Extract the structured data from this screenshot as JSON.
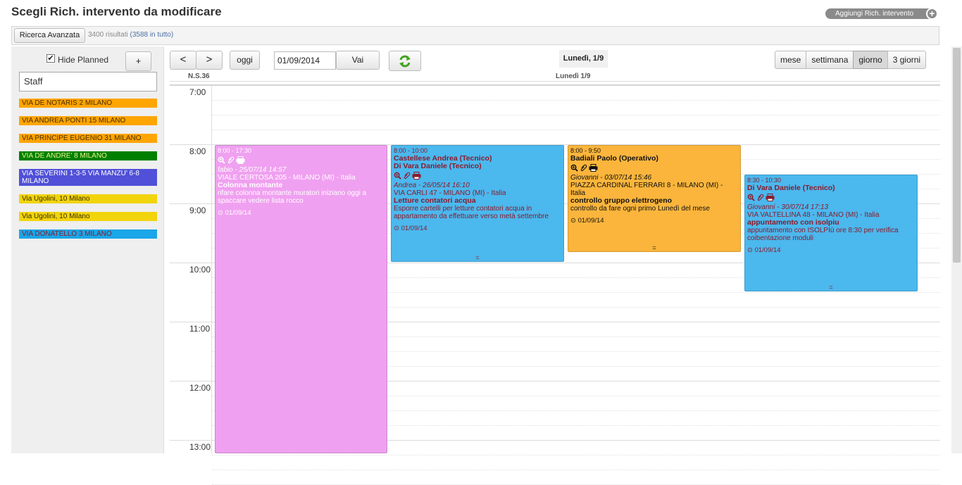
{
  "page": {
    "title": "Scegli Rich. intervento da modificare",
    "add_button": "Aggiungi Rich. intervento",
    "add_plus": "+"
  },
  "toolbar": {
    "advanced_search": "Ricerca Avanzata",
    "results_count": "3400 risultati",
    "results_total": "(3588 in tutto)"
  },
  "sidebar": {
    "hide_planned_label": "Hide Planned",
    "hide_planned_checked": true,
    "check_mark": "✔",
    "plus_label": "+",
    "staff_value": "Staff",
    "chips": [
      {
        "label": "VIA DE NOTARIS 2 MILANO",
        "bg": "#ffa500",
        "fg": "#4a2d00"
      },
      {
        "label": "VIA ANDREA PONTI 15 MILANO",
        "bg": "#ffa500",
        "fg": "#4a2d00"
      },
      {
        "label": "VIA PRINCIPE EUGENIO 31 MILANO",
        "bg": "#ffa500",
        "fg": "#4a2d00"
      },
      {
        "label": "VIA DE ANDRE' 8 MILANO",
        "bg": "#008000",
        "fg": "#e9f48c"
      },
      {
        "label": "VIA SEVERINI 1-3-5 VIA MANZU' 6-8 MILANO",
        "bg": "#5050d8",
        "fg": "#ffffff"
      },
      {
        "label": "Via Ugolini, 10 Milano",
        "bg": "#f2d40c",
        "fg": "#3a2e00"
      },
      {
        "label": "Via Ugolini, 10 Milano",
        "bg": "#f2d40c",
        "fg": "#3a2e00"
      },
      {
        "label": "VIA DONATELLO 3 MILANO",
        "bg": "#1aa6e8",
        "fg": "#8b1b2b"
      }
    ]
  },
  "calendar": {
    "prev": "<",
    "next": ">",
    "today": "oggi",
    "date_value": "01/09/2014",
    "go": "Vai",
    "title": "Lunedì, 1/9",
    "views": [
      "mese",
      "settimana",
      "giorno",
      "3 giorni"
    ],
    "active_view": "giorno",
    "week_label": "N.S.36",
    "day_header": "Lunedì 1/9",
    "hours": [
      "7:00",
      "8:00",
      "9:00",
      "10:00",
      "11:00",
      "12:00",
      "13:00"
    ],
    "events": [
      {
        "time": "8:00 - 17:30",
        "staff": [],
        "author": "fabio - 25/07/14 14:57",
        "address": "VIALE CERTOSA 205 - MILANO (MI) - Italia",
        "title": "Colonna montante",
        "desc": "rifare colonna montante muratori iniziano oggi a spaccare vedere lista rocco",
        "date": "⊙ 01/09/14",
        "bg": "#f0a0f0",
        "fg": "#ffffff",
        "icon_color": "#ffffff"
      },
      {
        "time": "8:00 - 10:00",
        "staff": [
          "Castellese Andrea (Tecnico)",
          "Di Vara Daniele (Tecnico)"
        ],
        "author": "Andrea - 26/05/14 16:10",
        "address": "VIA CARLI 47 - MILANO (MI) - Italia",
        "title": "Letture contatori acqua",
        "desc": "Esporre cartelli per letture contatori acqua in appartamento da effettuare verso metà settembre",
        "date": "⊙ 01/09/14",
        "bg": "#4bb8ee",
        "fg": "#8b1b2b",
        "icon_color": "#8b1b2b"
      },
      {
        "time": "8:00 - 9:50",
        "staff": [
          "Badiali Paolo (Operativo)"
        ],
        "author": "Giovanni - 03/07/14 15:46",
        "address": "PIAZZA CARDINAL FERRARI 8 - MILANO (MI) - Italia",
        "title": "controllo gruppo elettrogeno",
        "desc": "controllo da fare ogni primo Lunedì del mese",
        "date": "⊙ 01/09/14",
        "bg": "#fbb53c",
        "fg": "#111111",
        "icon_color": "#111111"
      },
      {
        "time": "8:30 - 10:30",
        "staff": [
          "Di Vara Daniele (Tecnico)"
        ],
        "author": "Giovanni - 30/07/14 17:13",
        "address": "VIA VALTELLINA 48 - MILANO (MI) - Italia",
        "title": "appuntamento con isolpiu",
        "desc": "appuntamento con ISOLPIù ore 8:30 per verifica coibentazione moduli",
        "date": "⊙ 01/09/14",
        "bg": "#4bb8ee",
        "fg": "#8b1b2b",
        "icon_color": "#8b1b2b"
      }
    ]
  }
}
